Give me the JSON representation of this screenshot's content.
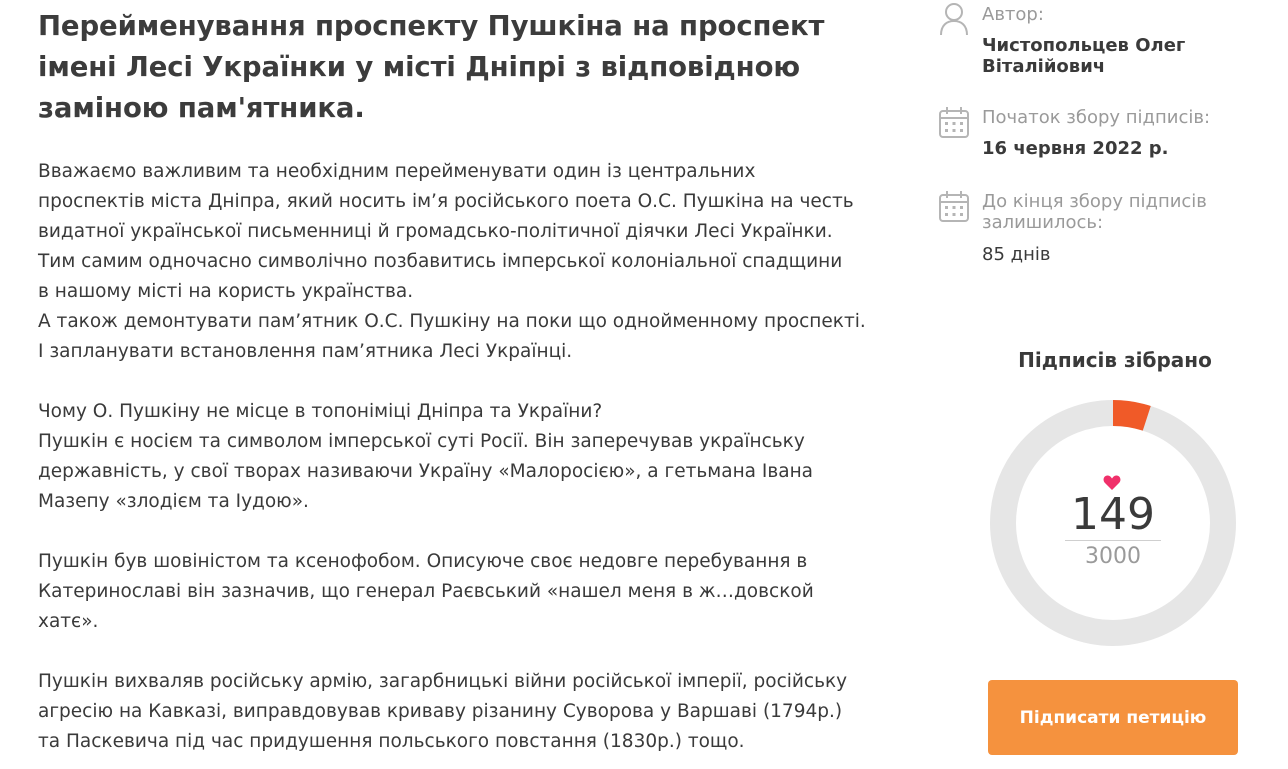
{
  "petition": {
    "title_lines": [
      "Перейменування проспекту Пушкіна на проспект",
      "імені Лесі Українки у місті Дніпрі з відповідною",
      "заміною пам'ятника."
    ],
    "paragraphs": [
      [
        "Вважаємо важливим та необхідним перейменувати один із центральних",
        "проспектів міста Дніпра, який носить ім’я російського поета О.С. Пушкіна на честь",
        "видатної української письменниці й громадсько-політичної діячки Лесі Українки.",
        "Тим самим одночасно символічно позбавитись імперської колоніальної спадщини",
        "в нашому місті на користь українства.",
        "А також демонтувати пам’ятник О.С. Пушкіну на поки що однойменному проспекті.",
        "І запланувати встановлення пам’ятника Лесі Українці."
      ],
      [
        "Чому О. Пушкіну не місце в топоніміці Дніпра та України?",
        "Пушкін є носієм та символом імперської суті Росії. Він заперечував українську",
        "державність, у свої творах називаючи Україну «Малоросією», а гетьмана Івана",
        "Мазепу «злодієм та Іудою»."
      ],
      [
        "Пушкін був шовіністом та ксенофобом. Описуюче своє недовге перебування в",
        "Катеринославі він зазначив, що генерал Раєвський «нашел меня в ж…довской",
        "хатє»."
      ],
      [
        "Пушкін вихваляв російську армію, загарбницькі війни російської імперії, російську",
        "агресію на Кавказі, виправдовував криваву різанину Суворова у Варшаві (1794р.)",
        "та Паскевича під час придушення польського повстання (1830р.) тощо."
      ]
    ]
  },
  "sidebar": {
    "author_label": "Автор:",
    "author_name_lines": [
      "Чистопольцев Олег",
      "Віталійович"
    ],
    "start_label": "Початок збору підписів:",
    "start_date": "16 червня 2022 р.",
    "remaining_label_lines": [
      "До кінця збору підписів",
      "залишилось:"
    ],
    "remaining_value": "85 днів",
    "icons": {
      "author": "user-icon",
      "start": "calendar-icon",
      "remaining": "calendar-icon"
    }
  },
  "signatures": {
    "title": "Підписів зібрано",
    "count": "149",
    "goal": "3000",
    "progress_fraction": 0.0497
  },
  "actions": {
    "sign_label": "Підписати петицію"
  },
  "colors": {
    "accent_orange": "#f5923e",
    "progress_red": "#f05a28",
    "ring_track": "#e6e6e6",
    "heart_pink": "#f0306a"
  }
}
